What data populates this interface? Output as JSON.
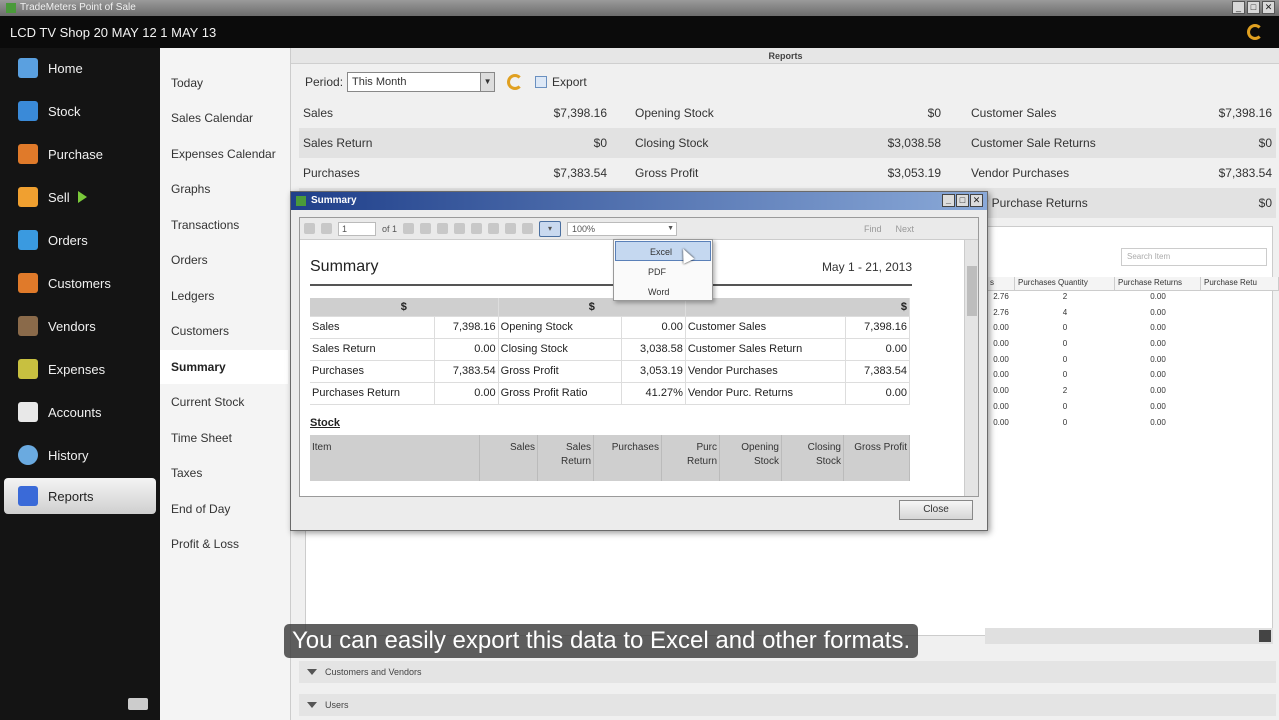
{
  "window": {
    "title": "TradeMeters Point of Sale",
    "btns": [
      "_",
      "□",
      "✕"
    ]
  },
  "shop": {
    "name": "LCD TV Shop 20 MAY 12 1 MAY 13"
  },
  "nav": {
    "items": [
      {
        "label": "Home",
        "icon": "home-icon",
        "color": "#5aa0e0"
      },
      {
        "label": "Stock",
        "icon": "stock-icon",
        "color": "#3a8ad8"
      },
      {
        "label": "Purchase",
        "icon": "purchase-basket-icon",
        "color": "#e07a2a"
      },
      {
        "label": "Sell",
        "icon": "sell-icon",
        "color": "#f0a030"
      },
      {
        "label": "Orders",
        "icon": "orders-arrow-icon",
        "color": "#3a9ae0"
      },
      {
        "label": "Customers",
        "icon": "customers-icon",
        "color": "#e07a2a"
      },
      {
        "label": "Vendors",
        "icon": "vendors-icon",
        "color": "#8a6a4a"
      },
      {
        "label": "Expenses",
        "icon": "expenses-icon",
        "color": "#c8c040"
      },
      {
        "label": "Accounts",
        "icon": "accounts-icon",
        "color": "#e8e8e8"
      },
      {
        "label": "History",
        "icon": "history-icon",
        "color": "#6aaae0"
      },
      {
        "label": "Reports",
        "icon": "reports-chart-icon",
        "color": "#3a6ad8"
      }
    ]
  },
  "submenu": {
    "items": [
      "Today",
      "Sales Calendar",
      "Expenses Calendar",
      "Graphs",
      "Transactions",
      "Orders",
      "Ledgers",
      "Customers",
      "Summary",
      "Current Stock",
      "Time Sheet",
      "Taxes",
      "End of Day",
      "Profit & Loss"
    ]
  },
  "reports": {
    "title": "Reports",
    "period_label": "Period:",
    "period_value": "This Month",
    "export_label": "Export",
    "stats": [
      [
        [
          "Sales",
          "$7,398.16"
        ],
        [
          "Opening Stock",
          "$0"
        ],
        [
          "Customer Sales",
          "$7,398.16"
        ]
      ],
      [
        [
          "Sales Return",
          "$0"
        ],
        [
          "Closing Stock",
          "$3,038.58"
        ],
        [
          "Customer Sale Returns",
          "$0"
        ]
      ],
      [
        [
          "Purchases",
          "$7,383.54"
        ],
        [
          "Gross Profit",
          "$3,053.19"
        ],
        [
          "Vendor Purchases",
          "$7,383.54"
        ]
      ],
      [
        [
          "",
          ""
        ],
        [
          "",
          ""
        ],
        [
          "dor Purchase Returns",
          "$0"
        ]
      ]
    ],
    "search_placeholder": "Search Item",
    "bg_headers": [
      "s",
      "Purchases Quantity",
      "Purchase Returns",
      "Purchase Retu"
    ],
    "bg_rows": [
      [
        "2.76",
        "2",
        "0.00"
      ],
      [
        "2.76",
        "4",
        "0.00"
      ],
      [
        "0.00",
        "0",
        "0.00"
      ],
      [
        "0.00",
        "0",
        "0.00"
      ],
      [
        "0.00",
        "0",
        "0.00"
      ],
      [
        "0.00",
        "0",
        "0.00"
      ],
      [
        "0.00",
        "2",
        "0.00"
      ],
      [
        "0.00",
        "0",
        "0.00"
      ],
      [
        "0.00",
        "0",
        "0.00"
      ]
    ],
    "sections": [
      "Customers and Vendors",
      "Users"
    ]
  },
  "dialog": {
    "title": "Summary",
    "page": "1",
    "of_pages": "of 1",
    "zoom": "100%",
    "find": "Find",
    "next": "Next",
    "report_title": "Summary",
    "report_date": "May 1 - 21, 2013",
    "currency": "$",
    "rows": [
      [
        "Sales",
        "7,398.16",
        "Opening Stock",
        "0.00",
        "Customer Sales",
        "7,398.16"
      ],
      [
        "Sales Return",
        "0.00",
        "Closing Stock",
        "3,038.58",
        "Customer Sales Return",
        "0.00"
      ],
      [
        "Purchases",
        "7,383.54",
        "Gross Profit",
        "3,053.19",
        "Vendor Purchases",
        "7,383.54"
      ],
      [
        "Purchases Return",
        "0.00",
        "Gross Profit Ratio",
        "41.27%",
        "Vendor Purc. Returns",
        "0.00"
      ]
    ],
    "stock_heading": "Stock",
    "stock_cols": [
      "Item",
      "Sales",
      "Sales Return",
      "Purchases",
      "Purc Return",
      "Opening Stock",
      "Closing Stock",
      "Gross Profit"
    ],
    "close": "Close"
  },
  "export_menu": [
    "Excel",
    "PDF",
    "Word"
  ],
  "subtitle": "You can easily export this data to Excel and other formats."
}
